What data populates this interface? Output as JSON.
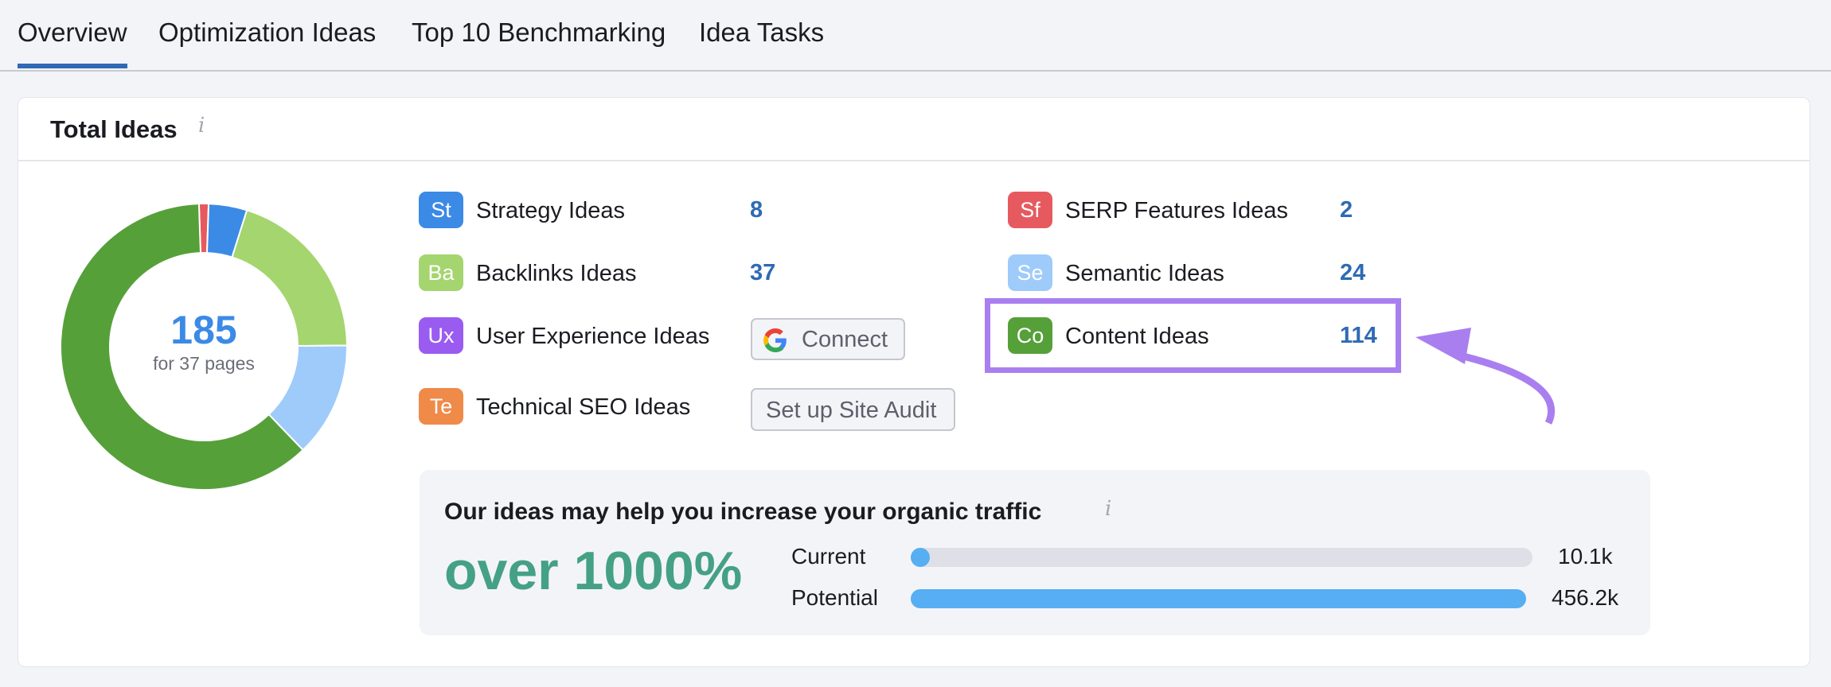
{
  "tabs": [
    {
      "label": "Overview",
      "active": true
    },
    {
      "label": "Optimization Ideas",
      "active": false
    },
    {
      "label": "Top 10 Benchmarking",
      "active": false
    },
    {
      "label": "Idea Tasks",
      "active": false
    }
  ],
  "card": {
    "title": "Total Ideas",
    "info_icon": "i"
  },
  "donut": {
    "total": "185",
    "subtitle": "for 37 pages"
  },
  "ideas": {
    "strategy": {
      "badge": "St",
      "label": "Strategy Ideas",
      "value": "8",
      "color": "#3b8ae6"
    },
    "backlinks": {
      "badge": "Ba",
      "label": "Backlinks Ideas",
      "value": "37",
      "color": "#a5d56e"
    },
    "ux": {
      "badge": "Ux",
      "label": "User Experience Ideas",
      "button": "Connect",
      "button_icon": "google-icon",
      "color": "#9a5cf0"
    },
    "technical": {
      "badge": "Te",
      "label": "Technical SEO Ideas",
      "button": "Set up Site Audit",
      "color": "#f08a49"
    },
    "serp": {
      "badge": "Sf",
      "label": "SERP Features Ideas",
      "value": "2",
      "color": "#e65a5f"
    },
    "semantic": {
      "badge": "Se",
      "label": "Semantic Ideas",
      "value": "24",
      "color": "#9ecbfa"
    },
    "content": {
      "badge": "Co",
      "label": "Content Ideas",
      "value": "114",
      "color": "#56a03a"
    }
  },
  "traffic": {
    "title": "Our ideas may help you increase your organic traffic",
    "info_icon": "i",
    "headline": "over 1000%",
    "current_label": "Current",
    "current_value": "10.1k",
    "current_fraction": 0.022,
    "potential_label": "Potential",
    "potential_value": "456.2k",
    "potential_fraction": 0.99
  },
  "annotation": {
    "highlight_color": "#a97ff0"
  },
  "chart_data": {
    "type": "pie",
    "title": "Total Ideas",
    "center_label": "185",
    "center_sublabel": "for 37 pages",
    "categories": [
      "SERP Features Ideas",
      "Strategy Ideas",
      "Backlinks Ideas",
      "Semantic Ideas",
      "Content Ideas"
    ],
    "values": [
      2,
      8,
      37,
      24,
      114
    ],
    "colors": [
      "#e65a5f",
      "#3b8ae6",
      "#a5d56e",
      "#9ecbfa",
      "#56a03a"
    ]
  }
}
